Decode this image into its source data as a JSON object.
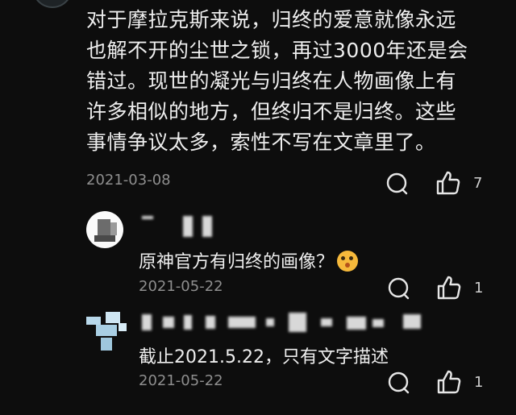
{
  "comment": {
    "text": "对于摩拉克斯来说，归终的爱意就像永远\n也解不开的尘世之锁，再过3000年还是会\n错过。现世的凝光与归终在人物画像上有\n许多相似的地方，但终归不是归终。这些\n事情争议太多，索性不写在文章里了。",
    "date": "2021-03-08",
    "like_count": "7"
  },
  "replies": [
    {
      "text": "原神官方有归终的画像？",
      "emoji": "face-with-open-mouth-emoji",
      "date": "2021-05-22",
      "like_count": "1"
    },
    {
      "text": "截止2021.5.22，只有文字描述",
      "date": "2021-05-22",
      "like_count": "1"
    }
  ],
  "icons": {
    "reply": "comment-bubble-icon",
    "like": "thumbs-up-icon"
  },
  "colors": {
    "background": "#0d0d0d",
    "text": "#eeeeee",
    "meta": "#8e8e8e",
    "avatar_accent": "#b8d8ea"
  }
}
